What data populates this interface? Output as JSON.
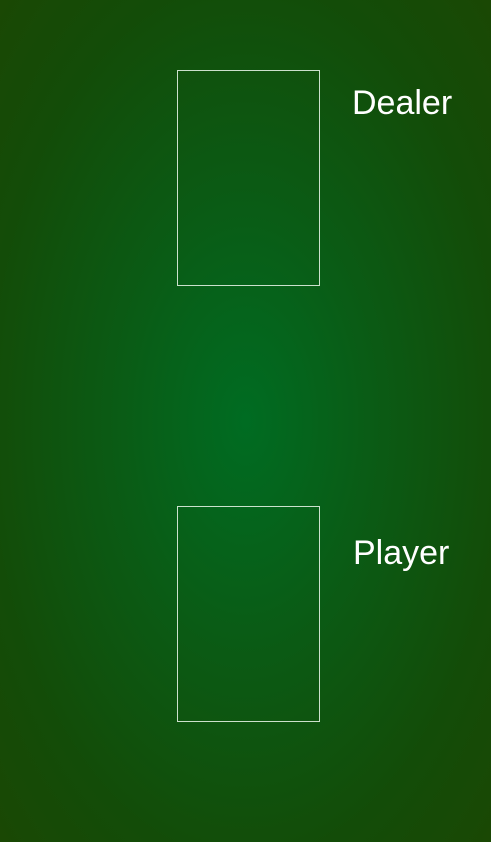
{
  "table": {
    "felt_color": "#0b5a14",
    "felt_center_color": "#006c22",
    "slot_border_color": "#e1f0e1"
  },
  "dealer": {
    "label": "Dealer"
  },
  "player": {
    "label": "Player"
  }
}
